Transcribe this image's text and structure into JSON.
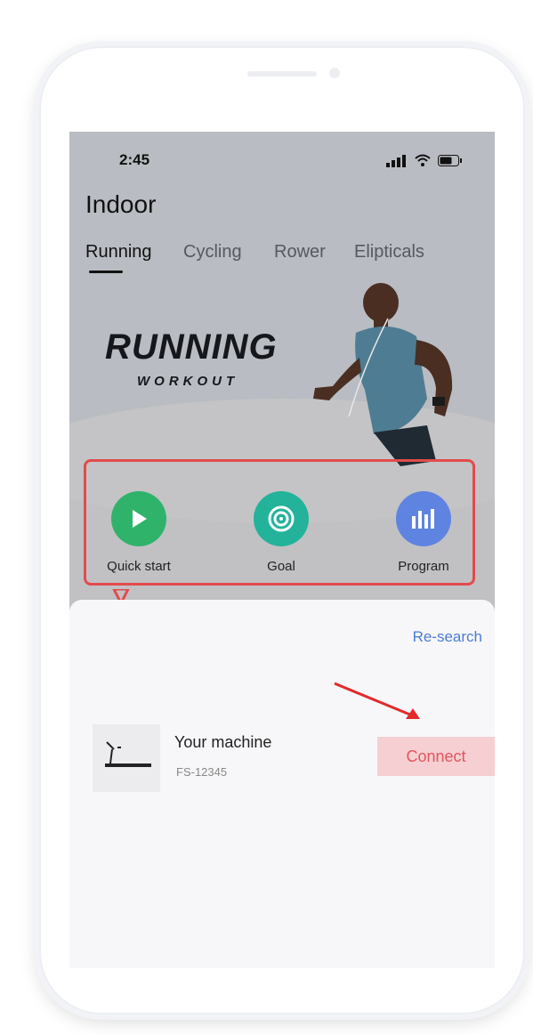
{
  "status_bar": {
    "time": "2:45"
  },
  "header": {
    "title": "Indoor"
  },
  "tabs": [
    {
      "label": "Running",
      "active": true
    },
    {
      "label": "Cycling",
      "active": false
    },
    {
      "label": "Rower",
      "active": false
    },
    {
      "label": "Elipticals",
      "active": false
    }
  ],
  "hero": {
    "title": "RUNNING",
    "subtitle": "WORKOUT"
  },
  "actions": [
    {
      "label": "Quick start",
      "icon": "play-icon",
      "color": "#2fb36a"
    },
    {
      "label": "Goal",
      "icon": "target-icon",
      "color": "#22b39a"
    },
    {
      "label": "Program",
      "icon": "program-icon",
      "color": "#5f83e0"
    }
  ],
  "sheet": {
    "research_label": "Re-search",
    "machine": {
      "name": "Your machine",
      "model": "FS-12345"
    },
    "connect_label": "Connect"
  },
  "colors": {
    "highlight": "#e34b4b",
    "link": "#4b7cd6",
    "connect_bg": "#f6cfd2",
    "connect_text": "#e0555c"
  }
}
